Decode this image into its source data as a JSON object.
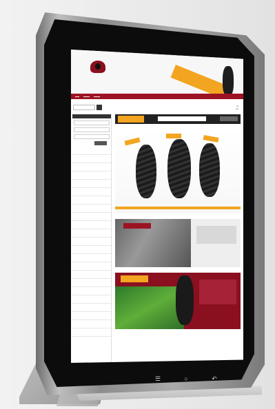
{
  "scene": {
    "subject": "tablet-on-stand",
    "colors": {
      "brand_red": "#9c1324",
      "accent_orange": "#f2a520",
      "bezel": "#0c0c0c",
      "frame_silver": "#a9a9a9",
      "background": "#eeeeee"
    },
    "icons": [
      "menu-icon",
      "home-icon",
      "back-icon"
    ]
  }
}
